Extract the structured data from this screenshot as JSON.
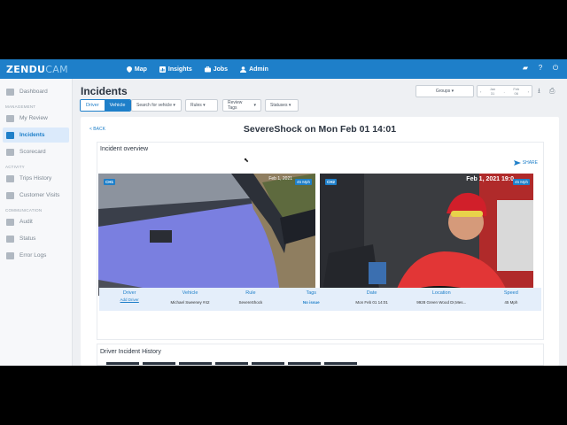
{
  "nav": {
    "logo_main": "ZENDU",
    "logo_sub": "CAM",
    "items": [
      {
        "label": "Map",
        "icon": "map-pin-icon"
      },
      {
        "label": "Insights",
        "icon": "insights-icon"
      },
      {
        "label": "Jobs",
        "icon": "briefcase-icon"
      },
      {
        "label": "Admin",
        "icon": "user-icon"
      }
    ],
    "right_icons": [
      "chat-icon",
      "help-icon",
      "power-icon"
    ]
  },
  "sidebar": {
    "items": [
      {
        "label": "Dashboard",
        "section": ""
      },
      {
        "label": "My Review",
        "section": "MANAGEMENT"
      },
      {
        "label": "Incidents",
        "section": "",
        "active": true
      },
      {
        "label": "Scorecard",
        "section": ""
      },
      {
        "label": "Trips History",
        "section": "ACTIVITY"
      },
      {
        "label": "Customer Visits",
        "section": ""
      },
      {
        "label": "Audit",
        "section": "COMMUNICATION"
      },
      {
        "label": "Status",
        "section": ""
      },
      {
        "label": "Error Logs",
        "section": ""
      }
    ]
  },
  "header": {
    "title": "Incidents",
    "toggle": [
      "Driver",
      "Vehicle"
    ],
    "filters": [
      "Search for vehicle",
      "Rules",
      "Review Tags",
      "Statuses"
    ],
    "groups": "Groups",
    "date_from": {
      "month": "Jan",
      "day": "31"
    },
    "date_to": {
      "month": "Feb",
      "day": "06"
    }
  },
  "incident": {
    "back": "< BACK",
    "title": "SevereShock on Mon Feb 01 14:01",
    "overview_title": "Incident overview",
    "share": "SHARE",
    "cam1": {
      "channel": "CH1",
      "timestamp": "Feb 1, 2021",
      "speed": "45 Mph"
    },
    "cam2": {
      "channel": "CH2",
      "timestamp": "Feb 1, 2021  19:0",
      "speed": "45 Mph"
    },
    "columns": [
      {
        "header": "Driver",
        "value": "Add Driver",
        "link": true
      },
      {
        "header": "Vehicle",
        "value": "Michael Sweeney #42"
      },
      {
        "header": "Rule",
        "value": "SevereShock"
      },
      {
        "header": "Tags",
        "value": "No issue"
      },
      {
        "header": "Date",
        "value": "Mon Feb 01 14:01"
      },
      {
        "header": "Location",
        "value": "9928 Green Wood Dr,Mes..."
      },
      {
        "header": "Speed",
        "value": "45 Mph"
      }
    ],
    "history_title": "Driver Incident History"
  },
  "colors": {
    "brand": "#1e7fc9",
    "highlight": "#e4eefa"
  }
}
